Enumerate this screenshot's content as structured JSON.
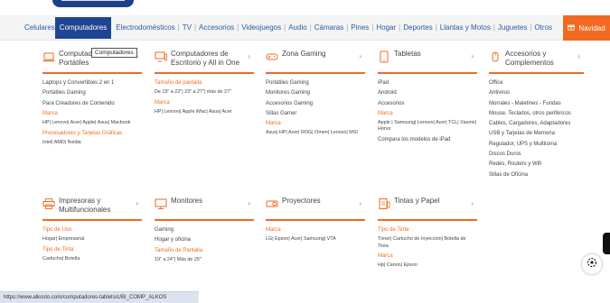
{
  "nav": {
    "items": [
      "Celulares",
      "Computadores",
      "Electrodomésticos",
      "TV",
      "Accesorios",
      "Videojuegos",
      "Audio",
      "Cámaras",
      "Pines",
      "Hogar",
      "Deportes",
      "Llantas y Motos",
      "Juguetes",
      "Otros"
    ],
    "active": "Computadores",
    "navidad": "Navidad"
  },
  "tooltip": "Computadores",
  "columns": {
    "portatiles": {
      "title": "Computadores Portátiles",
      "links": [
        "Laptops y Convertibles 2 en 1",
        "Portátiles Gaming",
        "Para Creadores de Contenido"
      ],
      "marca_label": "Marca",
      "marca_value": "HP| Lenovo| Acer| Apple| Asus| Macbook",
      "proc_label": "Procesadores y Tarjetas Gráficas",
      "proc_value": "Intel| AMD| Nvidia"
    },
    "escritorio": {
      "title": "Computadores de Escritorio y All in One",
      "size_label": "Tamaño de pantalla",
      "size_value": "De 19\" a 22\"| 23\" a 27\"| más de 27\"",
      "marca_label": "Marca",
      "marca_value": "HP| Lenovo| Apple iMac| Asus| Acer"
    },
    "gaming": {
      "title": "Zona Gaming",
      "links": [
        "Portátiles Gaming",
        "Monitores Gaming",
        "Accesorios Gaming",
        "Sillas Gamer"
      ],
      "marca_label": "Marca",
      "marca_value": "Asus| HP| Acer| ROG| Omen| Lenovo| MSI"
    },
    "tabletas": {
      "title": "Tabletas",
      "links": [
        "iPad",
        "Android",
        "Accesorios"
      ],
      "marca_label": "Marca",
      "marca_value": "Apple | Samsung| Lenovo| Acer| TCL| Xiaomi| Honor",
      "compare": "Compara los modelos de iPad"
    },
    "accesorios": {
      "title": "Accesorios y Complementos",
      "links": [
        "Office",
        "Antivirus",
        "Morrales - Maletines - Fundas",
        "Mouse, Teclados, otros periféricos",
        "Cables, Cargadores, Adaptadores",
        "USB y Tarjetas de Memoria",
        "Regulador, UPS y Multitoma",
        "Discos Duros",
        "Redes, Routers y Wifi",
        "Sillas de Oficina"
      ]
    },
    "impresoras": {
      "title": "Impresoras y Multifuncionales",
      "tipo_uso_label": "Tipo de Uso",
      "tipo_uso_value": "Hogar| Empresarial",
      "tipo_tinta_label": "Tipo de Tinta",
      "tipo_tinta_value": "Cartucho| Botella"
    },
    "monitores": {
      "title": "Monitores",
      "links": [
        "Gaming",
        "Hogar y oficina"
      ],
      "size_label": "Tamaño de Pantalla",
      "size_value": "19\" a 24\"| Más de 25\""
    },
    "proyectores": {
      "title": "Proyectores",
      "marca_label": "Marca",
      "marca_value": "LG| Epson| Acer| Samsung| VTA"
    },
    "tintas": {
      "title": "Tintas y Papel",
      "tipo_label": "Tipo de Tinta",
      "tipo_value": "Tóner| Cartucho de Inyección| Botella de Tinta",
      "marca_label": "Marca",
      "marca_value": "Hp| Canon| Epson"
    }
  },
  "status_url": "https://www.alkosto.com/computadores-tablets/c/BI_COMP_ALKOS",
  "colors": {
    "accent": "#f26a21",
    "nav_active": "#1e4593",
    "link": "#2a5ba6"
  }
}
